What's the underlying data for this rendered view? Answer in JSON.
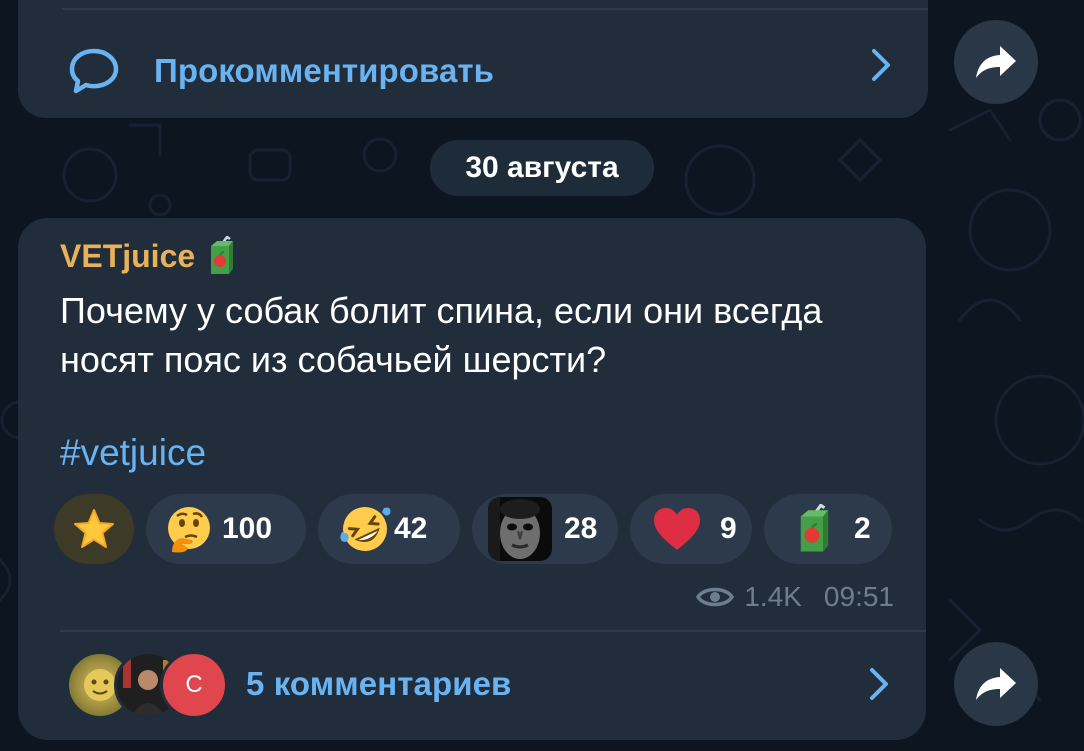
{
  "top_message": {
    "comment_label": "Прокомментировать"
  },
  "date_separator": "30 августа",
  "post": {
    "author": "VETjuice",
    "author_emoji": "juice-box-emoji",
    "text": "Почему у собак болит спина, если они всегда носят пояс из собачьей шерсти?",
    "hashtag": "#vetjuice",
    "reactions": [
      {
        "icon": "star-icon",
        "count": ""
      },
      {
        "icon": "thinking-face-emoji",
        "count": "100"
      },
      {
        "icon": "rofl-emoji",
        "count": "42"
      },
      {
        "icon": "uncanny-face-sticker",
        "count": "28"
      },
      {
        "icon": "red-heart-emoji",
        "count": "9"
      },
      {
        "icon": "juice-box-emoji",
        "count": "2"
      }
    ],
    "views": "1.4K",
    "time": "09:51",
    "comments_label": "5 комментариев",
    "commenter_avatar_letter": "C"
  },
  "colors": {
    "bubble": "#212d3b",
    "background": "#0d1521",
    "link": "#6ab3f3",
    "author": "#e9b25a",
    "meta": "#6d7f8f",
    "reaction_pill": "#2c3a4b"
  }
}
